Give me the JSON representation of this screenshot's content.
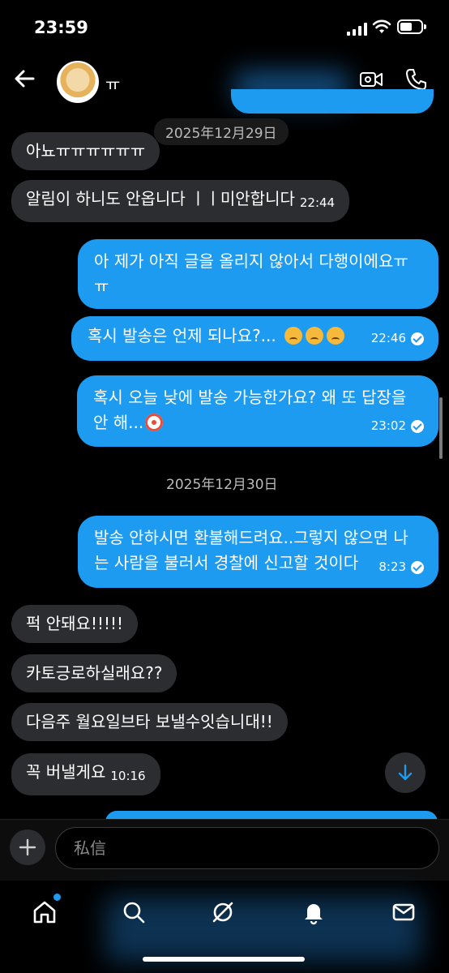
{
  "status_bar": {
    "time": "23:59"
  },
  "header": {
    "contact_name": "ㅠ",
    "back_icon": "arrow-left-icon",
    "video_icon": "video-call-icon",
    "phone_icon": "phone-icon"
  },
  "date_separators": [
    "2025年12月29日",
    "2025年12月30日"
  ],
  "messages": [
    {
      "side": "received",
      "text": "아뇨ㅠㅠㅠㅠㅠㅠ",
      "time": ""
    },
    {
      "side": "received",
      "text": "알림이 하니도 안옵니다 ㅣㅣ미안합니다",
      "time": "22:44"
    },
    {
      "side": "sent",
      "text": "아 제가 아직 글을 올리지 않아서 다행이에요ㅠㅠ",
      "time": ""
    },
    {
      "side": "sent",
      "text": "혹시 발송은 언제 되나요?...",
      "time": "22:46",
      "emoji": [
        "crying-cat-icon",
        "crying-cat-icon",
        "crying-cat-icon"
      ]
    },
    {
      "side": "sent",
      "text": "혹시 오늘 낮에 발송 가능한가요? 왜 또 답장을 안 해...",
      "time": "23:02",
      "emoji": [
        "clown-face-icon"
      ]
    },
    {
      "side": "sent",
      "text": "발송 안하시면 환불해드려요..그렇지 않으면 나는 사람을 불러서 경찰에 신고할 것이다",
      "time": "8:23"
    },
    {
      "side": "received",
      "text": "퍽 안돼요!!!!!",
      "time": ""
    },
    {
      "side": "received",
      "text": "카토긍로하실래요??",
      "time": ""
    },
    {
      "side": "received",
      "text": "다음주 월요일브타 보낼수잇습니대!!",
      "time": ""
    },
    {
      "side": "received",
      "text": "꼭 버낼게요",
      "time": "10:16"
    }
  ],
  "composer": {
    "placeholder": "私信"
  },
  "tab_bar": {
    "items": [
      "home-icon",
      "search-icon",
      "grok-icon",
      "notifications-icon",
      "messages-icon"
    ]
  },
  "colors": {
    "sent_bubble": "#1d9bf0",
    "received_bubble": "#2b2d31",
    "background": "#000000"
  }
}
